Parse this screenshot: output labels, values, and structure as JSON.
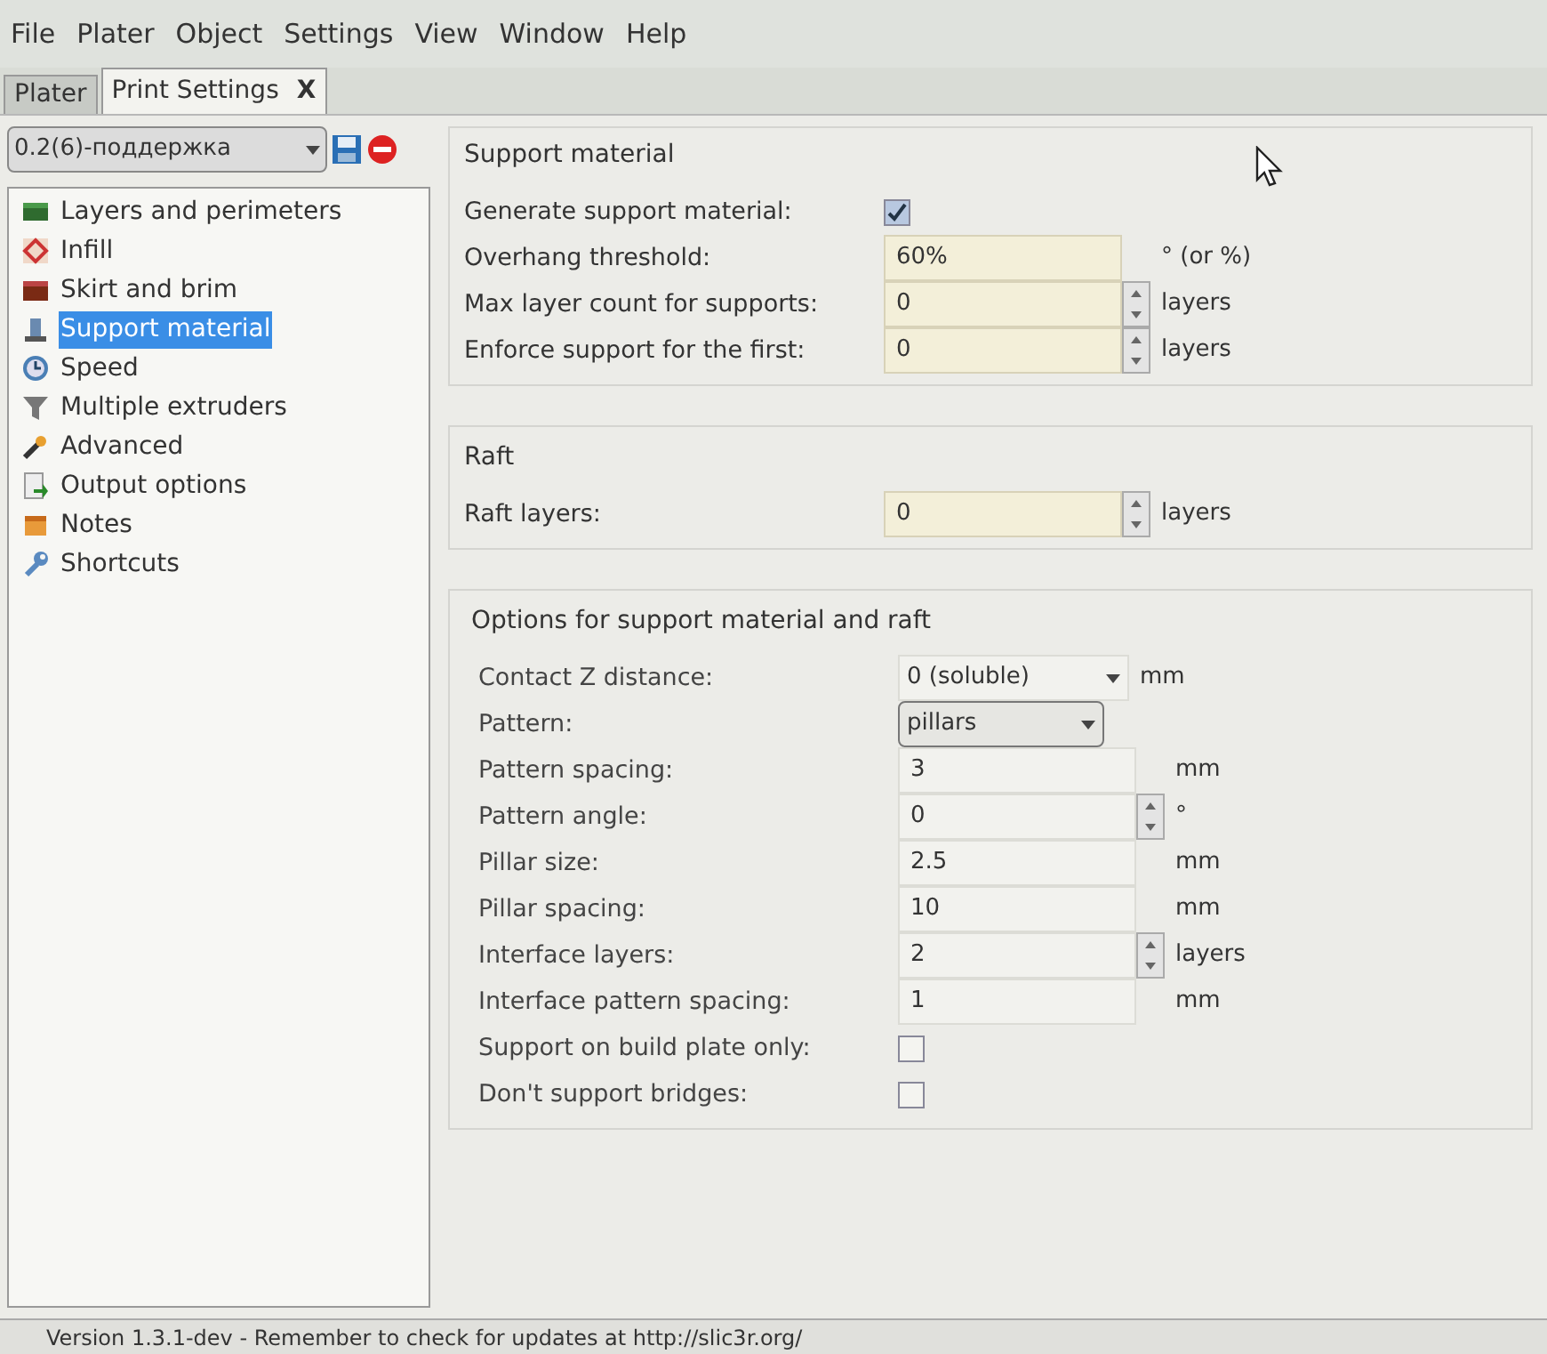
{
  "menu": [
    "File",
    "Plater",
    "Object",
    "Settings",
    "View",
    "Window",
    "Help"
  ],
  "tabs": [
    {
      "label": "Plater",
      "selected": false
    },
    {
      "label": "Print Settings",
      "selected": true,
      "close": "X"
    }
  ],
  "preset": {
    "value": "0.2(6)-поддержка"
  },
  "sidebar": {
    "items": [
      {
        "label": "Layers and perimeters",
        "selected": false
      },
      {
        "label": "Infill",
        "selected": false
      },
      {
        "label": "Skirt and brim",
        "selected": false
      },
      {
        "label": "Support material",
        "selected": true
      },
      {
        "label": "Speed",
        "selected": false
      },
      {
        "label": "Multiple extruders",
        "selected": false
      },
      {
        "label": "Advanced",
        "selected": false
      },
      {
        "label": "Output options",
        "selected": false
      },
      {
        "label": "Notes",
        "selected": false
      },
      {
        "label": "Shortcuts",
        "selected": false
      }
    ]
  },
  "sections": [
    {
      "title": "Support material",
      "rows": [
        {
          "label": "Generate support material:",
          "kind": "checkbox",
          "checked": true
        },
        {
          "label": "Overhang threshold:",
          "kind": "text",
          "value": "60%",
          "unit": "° (or %)"
        },
        {
          "label": "Max layer count for supports:",
          "kind": "spin",
          "value": "0",
          "unit": "layers"
        },
        {
          "label": "Enforce support for the first:",
          "kind": "spin",
          "value": "0",
          "unit": "layers"
        }
      ]
    },
    {
      "title": "Raft",
      "rows": [
        {
          "label": "Raft layers:",
          "kind": "spin",
          "value": "0",
          "unit": "layers"
        }
      ]
    },
    {
      "title": "Options for support material and raft",
      "rows": [
        {
          "label": "Contact Z distance:",
          "kind": "combo",
          "value": "0 (soluble)",
          "unit": "mm"
        },
        {
          "label": "Pattern:",
          "kind": "select",
          "value": "pillars"
        },
        {
          "label": "Pattern spacing:",
          "kind": "text",
          "value": "3",
          "unit": "mm"
        },
        {
          "label": "Pattern angle:",
          "kind": "spin",
          "value": "0",
          "unit": "°"
        },
        {
          "label": "Pillar size:",
          "kind": "text",
          "value": "2.5",
          "unit": "mm"
        },
        {
          "label": "Pillar spacing:",
          "kind": "text",
          "value": "10",
          "unit": "mm"
        },
        {
          "label": "Interface layers:",
          "kind": "spin",
          "value": "2",
          "unit": "layers"
        },
        {
          "label": "Interface pattern spacing:",
          "kind": "text",
          "value": "1",
          "unit": "mm"
        },
        {
          "label": "Support on build plate only:",
          "kind": "checkbox",
          "checked": false
        },
        {
          "label": "Don't support bridges:",
          "kind": "checkbox",
          "checked": false
        }
      ]
    }
  ],
  "status_bar": "Version 1.3.1-dev - Remember to check for updates at http://slic3r.org/"
}
